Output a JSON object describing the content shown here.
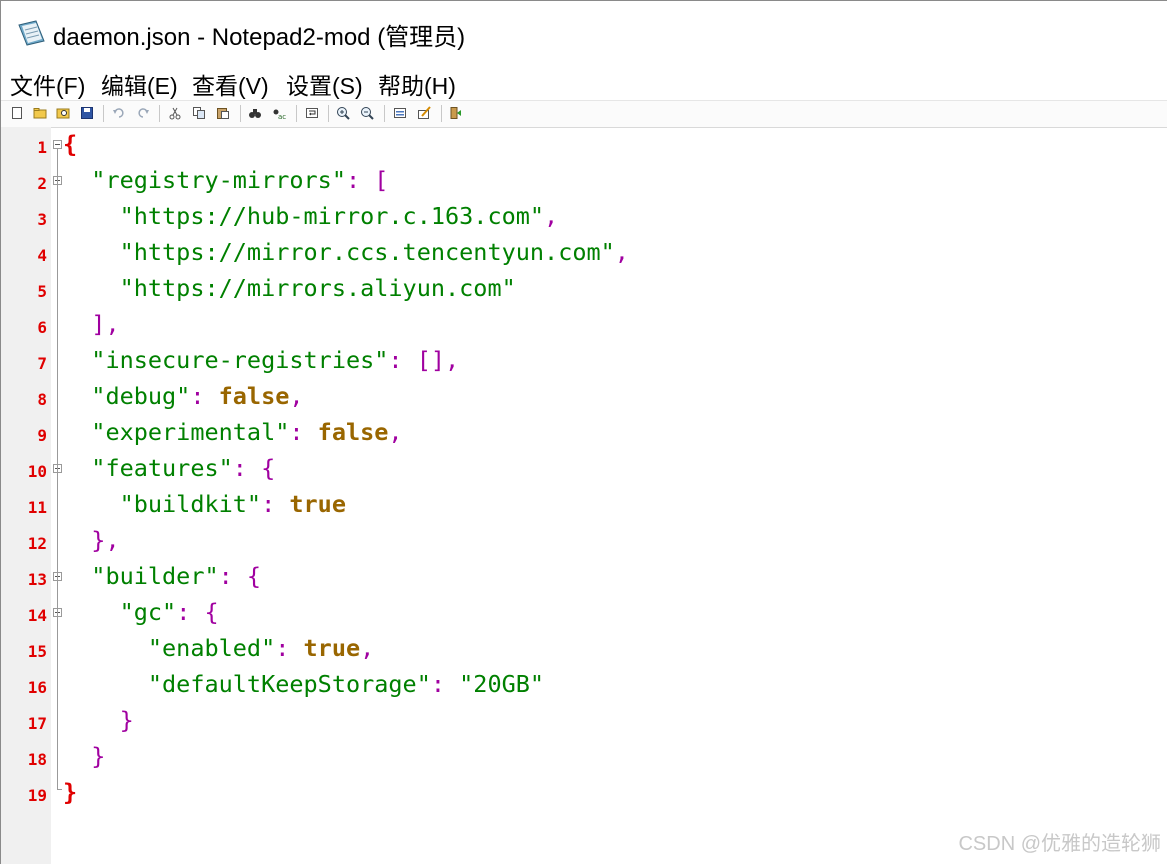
{
  "window": {
    "title": "daemon.json - Notepad2-mod (管理员)"
  },
  "menu": {
    "items": [
      "文件(F)",
      "编辑(E)",
      "查看(V)",
      "设置(S)",
      "帮助(H)"
    ]
  },
  "toolbar": {
    "icons": [
      "new-file-icon",
      "open-file-icon",
      "browse-icon",
      "save-icon",
      "undo-icon",
      "redo-icon",
      "cut-icon",
      "copy-icon",
      "paste-icon",
      "find-icon",
      "replace-icon",
      "word-wrap-icon",
      "zoom-in-icon",
      "zoom-out-icon",
      "select-scheme-icon",
      "customize-scheme-icon",
      "exit-icon"
    ]
  },
  "editor": {
    "line_numbers": [
      "1",
      "2",
      "3",
      "4",
      "5",
      "6",
      "7",
      "8",
      "9",
      "10",
      "11",
      "12",
      "13",
      "14",
      "15",
      "16",
      "17",
      "18",
      "19"
    ],
    "lines": [
      [
        {
          "t": "{",
          "c": "brace0"
        }
      ],
      [
        {
          "t": "  ",
          "c": ""
        },
        {
          "t": "\"registry-mirrors\"",
          "c": "s"
        },
        {
          "t": ": [",
          "c": "p"
        }
      ],
      [
        {
          "t": "    ",
          "c": ""
        },
        {
          "t": "\"https://hub-mirror.c.163.com\"",
          "c": "s"
        },
        {
          "t": ",",
          "c": "p"
        }
      ],
      [
        {
          "t": "    ",
          "c": ""
        },
        {
          "t": "\"https://mirror.ccs.tencentyun.com\"",
          "c": "s"
        },
        {
          "t": ",",
          "c": "p"
        }
      ],
      [
        {
          "t": "    ",
          "c": ""
        },
        {
          "t": "\"https://mirrors.aliyun.com\"",
          "c": "s"
        }
      ],
      [
        {
          "t": "  ",
          "c": ""
        },
        {
          "t": "],",
          "c": "p"
        }
      ],
      [
        {
          "t": "  ",
          "c": ""
        },
        {
          "t": "\"insecure-registries\"",
          "c": "s"
        },
        {
          "t": ": [],",
          "c": "p"
        }
      ],
      [
        {
          "t": "  ",
          "c": ""
        },
        {
          "t": "\"debug\"",
          "c": "s"
        },
        {
          "t": ": ",
          "c": "p"
        },
        {
          "t": "false",
          "c": "b"
        },
        {
          "t": ",",
          "c": "p"
        }
      ],
      [
        {
          "t": "  ",
          "c": ""
        },
        {
          "t": "\"experimental\"",
          "c": "s"
        },
        {
          "t": ": ",
          "c": "p"
        },
        {
          "t": "false",
          "c": "b"
        },
        {
          "t": ",",
          "c": "p"
        }
      ],
      [
        {
          "t": "  ",
          "c": ""
        },
        {
          "t": "\"features\"",
          "c": "s"
        },
        {
          "t": ": {",
          "c": "p"
        }
      ],
      [
        {
          "t": "    ",
          "c": ""
        },
        {
          "t": "\"buildkit\"",
          "c": "s"
        },
        {
          "t": ": ",
          "c": "p"
        },
        {
          "t": "true",
          "c": "b"
        }
      ],
      [
        {
          "t": "  ",
          "c": ""
        },
        {
          "t": "},",
          "c": "p"
        }
      ],
      [
        {
          "t": "  ",
          "c": ""
        },
        {
          "t": "\"builder\"",
          "c": "s"
        },
        {
          "t": ": {",
          "c": "p"
        }
      ],
      [
        {
          "t": "    ",
          "c": ""
        },
        {
          "t": "\"gc\"",
          "c": "s"
        },
        {
          "t": ": {",
          "c": "p"
        }
      ],
      [
        {
          "t": "      ",
          "c": ""
        },
        {
          "t": "\"enabled\"",
          "c": "s"
        },
        {
          "t": ": ",
          "c": "p"
        },
        {
          "t": "true",
          "c": "b"
        },
        {
          "t": ",",
          "c": "p"
        }
      ],
      [
        {
          "t": "      ",
          "c": ""
        },
        {
          "t": "\"defaultKeepStorage\"",
          "c": "s"
        },
        {
          "t": ": ",
          "c": "p"
        },
        {
          "t": "\"20GB\"",
          "c": "s"
        }
      ],
      [
        {
          "t": "    ",
          "c": ""
        },
        {
          "t": "}",
          "c": "p"
        }
      ],
      [
        {
          "t": "  ",
          "c": ""
        },
        {
          "t": "}",
          "c": "p"
        }
      ],
      [
        {
          "t": "}",
          "c": "brace0"
        }
      ]
    ],
    "fold_lines": [
      "1",
      "2",
      "10",
      "13",
      "14"
    ]
  },
  "watermark": "CSDN @优雅的造轮狮",
  "colors": {
    "line_number": "#e00000",
    "string": "#008000",
    "punctuation": "#a000a0",
    "boolean": "#996600",
    "gutter_bg": "#f0f0f0"
  }
}
